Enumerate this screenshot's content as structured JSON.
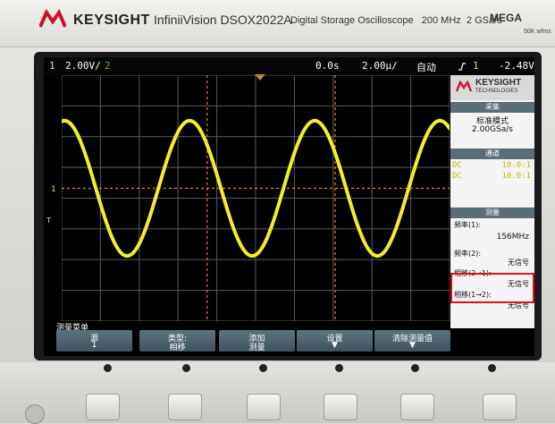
{
  "instrument": {
    "brand": "KEYSIGHT",
    "model": "InfiniiVision DSOX2022A",
    "description": "Digital Storage Oscilloscope",
    "bandwidth": "200 MHz",
    "sample_rate": "2 GSa/s",
    "series": "MEGA",
    "series_sub": "50K wfms"
  },
  "status_bar": {
    "ch1_label": "1",
    "ch1_scale": "2.00V/",
    "ch2_label": "2",
    "time_offset": "0.0s",
    "time_scale": "2.00µ/",
    "trigger_mode": "自动",
    "trigger_icon": "trigger-edge-icon",
    "trigger_source": "1",
    "trigger_level": "-2.48V"
  },
  "markers": {
    "ch1_ground": "1",
    "trigger_marker": "T"
  },
  "side_panel": {
    "brand": "KEYSIGHT",
    "brand_sub": "TECHNOLOGIES",
    "acquire_title": "采集",
    "acquire_mode": "标准模式",
    "acquire_rate": "2.00GSa/s",
    "channels_title": "通道",
    "channels": [
      {
        "coupling": "DC",
        "probe": "10.0:1"
      },
      {
        "coupling": "DC",
        "probe": "10.0:1"
      }
    ],
    "measure_title": "测量",
    "measurements": [
      {
        "label": "频率(1):",
        "value": "156MHz"
      },
      {
        "label": "频率(2):",
        "value": "无信号"
      },
      {
        "label": "相移(2→1):",
        "value": "无信号"
      },
      {
        "label": "相移(1→2):",
        "value": "无信号"
      }
    ]
  },
  "softkey_menu": {
    "title": "测量菜单",
    "keys": [
      {
        "line1": "源",
        "line2": "1"
      },
      {
        "line1": "类型:",
        "line2": "相移"
      },
      {
        "line1": "添加",
        "line2": "测量"
      },
      {
        "line1": "设置",
        "line2": "▼"
      },
      {
        "line1": "清除测量值",
        "line2": "▼"
      }
    ]
  },
  "colors": {
    "ch1_trace": "#f2ee2a",
    "grid": "#5c5c5c",
    "cursor": "#e08a1e",
    "softkey": "#4d636e",
    "highlight": "#e0101a"
  },
  "waveform": {
    "channel": "1",
    "shape": "sine",
    "cycles_visible": 3.1,
    "amplitude_divisions": 2.2
  }
}
